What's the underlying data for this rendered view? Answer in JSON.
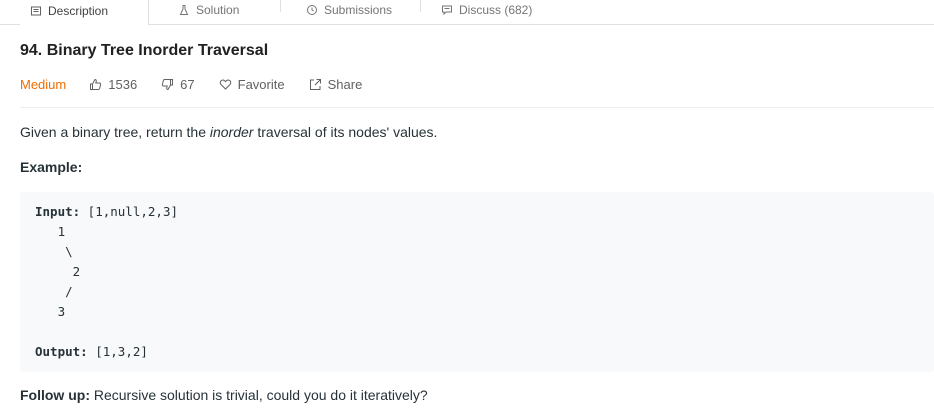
{
  "tabs": [
    {
      "label": "Description",
      "icon": "description-icon",
      "active": true
    },
    {
      "label": "Solution",
      "icon": "flask-icon",
      "active": false
    },
    {
      "label": "Submissions",
      "icon": "clock-icon",
      "active": false
    },
    {
      "label": "Discuss (682)",
      "icon": "comment-icon",
      "active": false
    }
  ],
  "problem": {
    "title": "94. Binary Tree Inorder Traversal",
    "difficulty": "Medium",
    "likes": "1536",
    "dislikes": "67",
    "favorite_label": "Favorite",
    "share_label": "Share"
  },
  "description": {
    "before": "Given a binary tree, return the ",
    "emphasis": "inorder",
    "after": " traversal of its nodes' values."
  },
  "example": {
    "label": "Example:",
    "input_label": "Input:",
    "input_value": " [1,null,2,3]",
    "tree_lines": [
      "   1",
      "    \\",
      "     2",
      "    /",
      "   3"
    ],
    "output_label": "Output:",
    "output_value": " [1,3,2]"
  },
  "followup": {
    "label": "Follow up:",
    "text": " Recursive solution is trivial, could you do it iteratively?"
  },
  "colors": {
    "difficulty_medium": "#ef6c00",
    "code_background": "#f7f9fa"
  }
}
